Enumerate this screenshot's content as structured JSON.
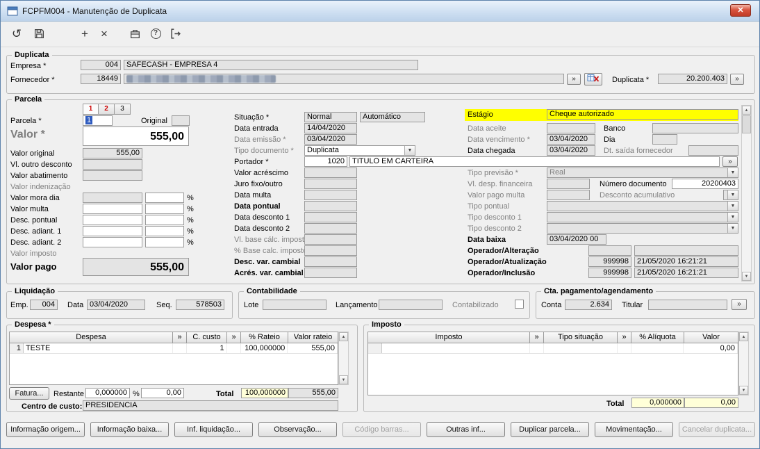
{
  "window": {
    "title": "FCPFM004 - Manutenção de Duplicata"
  },
  "ui": {
    "undo_glyph": "↺",
    "add_glyph": "+",
    "delete_glyph": "×",
    "help_glyph": "?",
    "close_glyph": "✕",
    "lookup_glyph": "»",
    "dropdown_glyph": "▼",
    "scroll_up_glyph": "▲",
    "scroll_down_glyph": "▼"
  },
  "toolbar": {
    "icons": [
      "undo",
      "save",
      "add",
      "delete",
      "archive",
      "help",
      "exit"
    ]
  },
  "duplicata": {
    "group_label": "Duplicata",
    "empresa_label": "Empresa *",
    "empresa_code": "004",
    "empresa_name": "SAFECASH -  EMPRESA 4",
    "fornecedor_label": "Fornecedor *",
    "fornecedor_code": "18449",
    "duplicata_label": "Duplicata *",
    "duplicata_value": "20.200.403"
  },
  "parcela": {
    "group_label": "Parcela",
    "tabs": [
      "1",
      "2",
      "3"
    ],
    "parcela_label": "Parcela *",
    "parcela_value": "1",
    "original_label": "Original",
    "valor_label": "Valor *",
    "valor_value": "555,00",
    "percent": "%",
    "left": {
      "valor_original_label": "Valor original",
      "valor_original_value": "555,00",
      "vl_outro_desconto_label": "Vl. outro desconto",
      "valor_abatimento_label": "Valor abatimento",
      "valor_indenizacao_label": "Valor indenização",
      "valor_mora_dia_label": "Valor mora dia",
      "valor_multa_label": "Valor multa",
      "desc_pontual_label": "Desc. pontual",
      "desc_adiant1_label": "Desc. adiant. 1",
      "desc_adiant2_label": "Desc. adiant. 2",
      "valor_imposto_label": "Valor imposto",
      "valor_pago_label": "Valor pago",
      "valor_pago_value": "555,00"
    },
    "mid": {
      "situacao_label": "Situação *",
      "situacao_value": "Normal",
      "situacao_auto": "Automático",
      "data_entrada_label": "Data entrada",
      "data_entrada_value": "14/04/2020",
      "data_emissao_label": "Data emissão *",
      "data_emissao_value": "03/04/2020",
      "tipo_documento_label": "Tipo documento *",
      "tipo_documento_value": "Duplicata",
      "portador_label": "Portador *",
      "portador_code": "1020",
      "portador_name": "TITULO EM CARTEIRA",
      "valor_acrescimo_label": "Valor acréscimo",
      "juro_fixo_label": "Juro fixo/outro",
      "data_multa_label": "Data multa",
      "data_pontual_label": "Data pontual",
      "data_desconto1_label": "Data desconto 1",
      "data_desconto2_label": "Data desconto 2",
      "vl_base_calc_label": "Vl. base cálc. imposto",
      "pct_base_calc_label": "% Base calc. imposto",
      "desc_var_cambial_label": "Desc. var. cambial",
      "acres_var_cambial_label": "Acrés. var. cambial"
    },
    "right": {
      "estagio_label": "Estágio",
      "estagio_value": "Cheque autorizado",
      "data_aceite_label": "Data aceite",
      "banco_label": "Banco",
      "data_vencimento_label": "Data vencimento *",
      "data_vencimento_value": "03/04/2020",
      "dia_label": "Dia",
      "data_chegada_label": "Data chegada",
      "data_chegada_value": "03/04/2020",
      "dt_saida_label": "Dt. saída fornecedor",
      "tipo_previsao_label": "Tipo previsão *",
      "tipo_previsao_value": "Real",
      "vl_desp_financeira_label": "Vl. desp. financeira",
      "numero_documento_label": "Número documento",
      "numero_documento_value": "20200403",
      "valor_pago_multa_label": "Valor pago multa",
      "desconto_acumulativo_label": "Desconto acumulativo",
      "tipo_pontual_label": "Tipo pontual",
      "tipo_desconto1_label": "Tipo desconto 1",
      "tipo_desconto2_label": "Tipo desconto 2",
      "data_baixa_label": "Data baixa",
      "data_baixa_value": "03/04/2020 00",
      "operador_alteracao_label": "Operador/Alteração",
      "operador_atualizacao_label": "Operador/Atualização",
      "operador_atualizacao_code": "999998",
      "operador_atualizacao_datetime": "21/05/2020 16:21:21",
      "operador_inclusao_label": "Operador/Inclusão",
      "operador_inclusao_code": "999998",
      "operador_inclusao_datetime": "21/05/2020 16:21:21"
    }
  },
  "liquidacao": {
    "group_label": "Liquidação",
    "emp_label": "Emp.",
    "emp_value": "004",
    "data_label": "Data",
    "data_value": "03/04/2020",
    "seq_label": "Seq.",
    "seq_value": "578503"
  },
  "contabilidade": {
    "group_label": "Contabilidade",
    "lote_label": "Lote",
    "lancamento_label": "Lançamento",
    "contabilizado_label": "Contabilizado"
  },
  "cta": {
    "group_label": "Cta. pagamento/agendamento",
    "conta_label": "Conta",
    "conta_value": "2.634",
    "titular_label": "Titular"
  },
  "despesa": {
    "group_label": "Despesa *",
    "headers": [
      "Despesa",
      "»",
      "C. custo",
      "»",
      "% Rateio",
      "Valor rateio"
    ],
    "row": {
      "num": "1",
      "despesa": "TESTE",
      "c_custo": "1",
      "rateio": "100,000000",
      "valor": "555,00"
    },
    "fatura_button": "Fatura...",
    "restante_label": "Restante",
    "restante_value": "0,000000",
    "percent": "%",
    "restante_valor": "0,00",
    "total_label": "Total",
    "total_rateio": "100,000000",
    "total_valor": "555,00",
    "centro_custo_label": "Centro de custo:",
    "centro_custo_value": "PRESIDENCIA"
  },
  "imposto": {
    "group_label": "Imposto",
    "headers": [
      "Imposto",
      "»",
      "Tipo situação",
      "»",
      "% Alíquota",
      "Valor"
    ],
    "row": {
      "valor": "0,00"
    },
    "total_label": "Total",
    "total_aliquota": "0,000000",
    "total_valor": "0,00"
  },
  "footer_buttons": [
    {
      "label": "Informação origem...",
      "enabled": true
    },
    {
      "label": "Informação baixa...",
      "enabled": true
    },
    {
      "label": "Inf. liquidação...",
      "enabled": true
    },
    {
      "label": "Observação...",
      "enabled": true
    },
    {
      "label": "Código barras...",
      "enabled": false
    },
    {
      "label": "Outras inf...",
      "enabled": true
    },
    {
      "label": "Duplicar parcela...",
      "enabled": true
    },
    {
      "label": "Movimentação...",
      "enabled": true
    },
    {
      "label": "Cancelar duplicata...",
      "enabled": false
    }
  ]
}
